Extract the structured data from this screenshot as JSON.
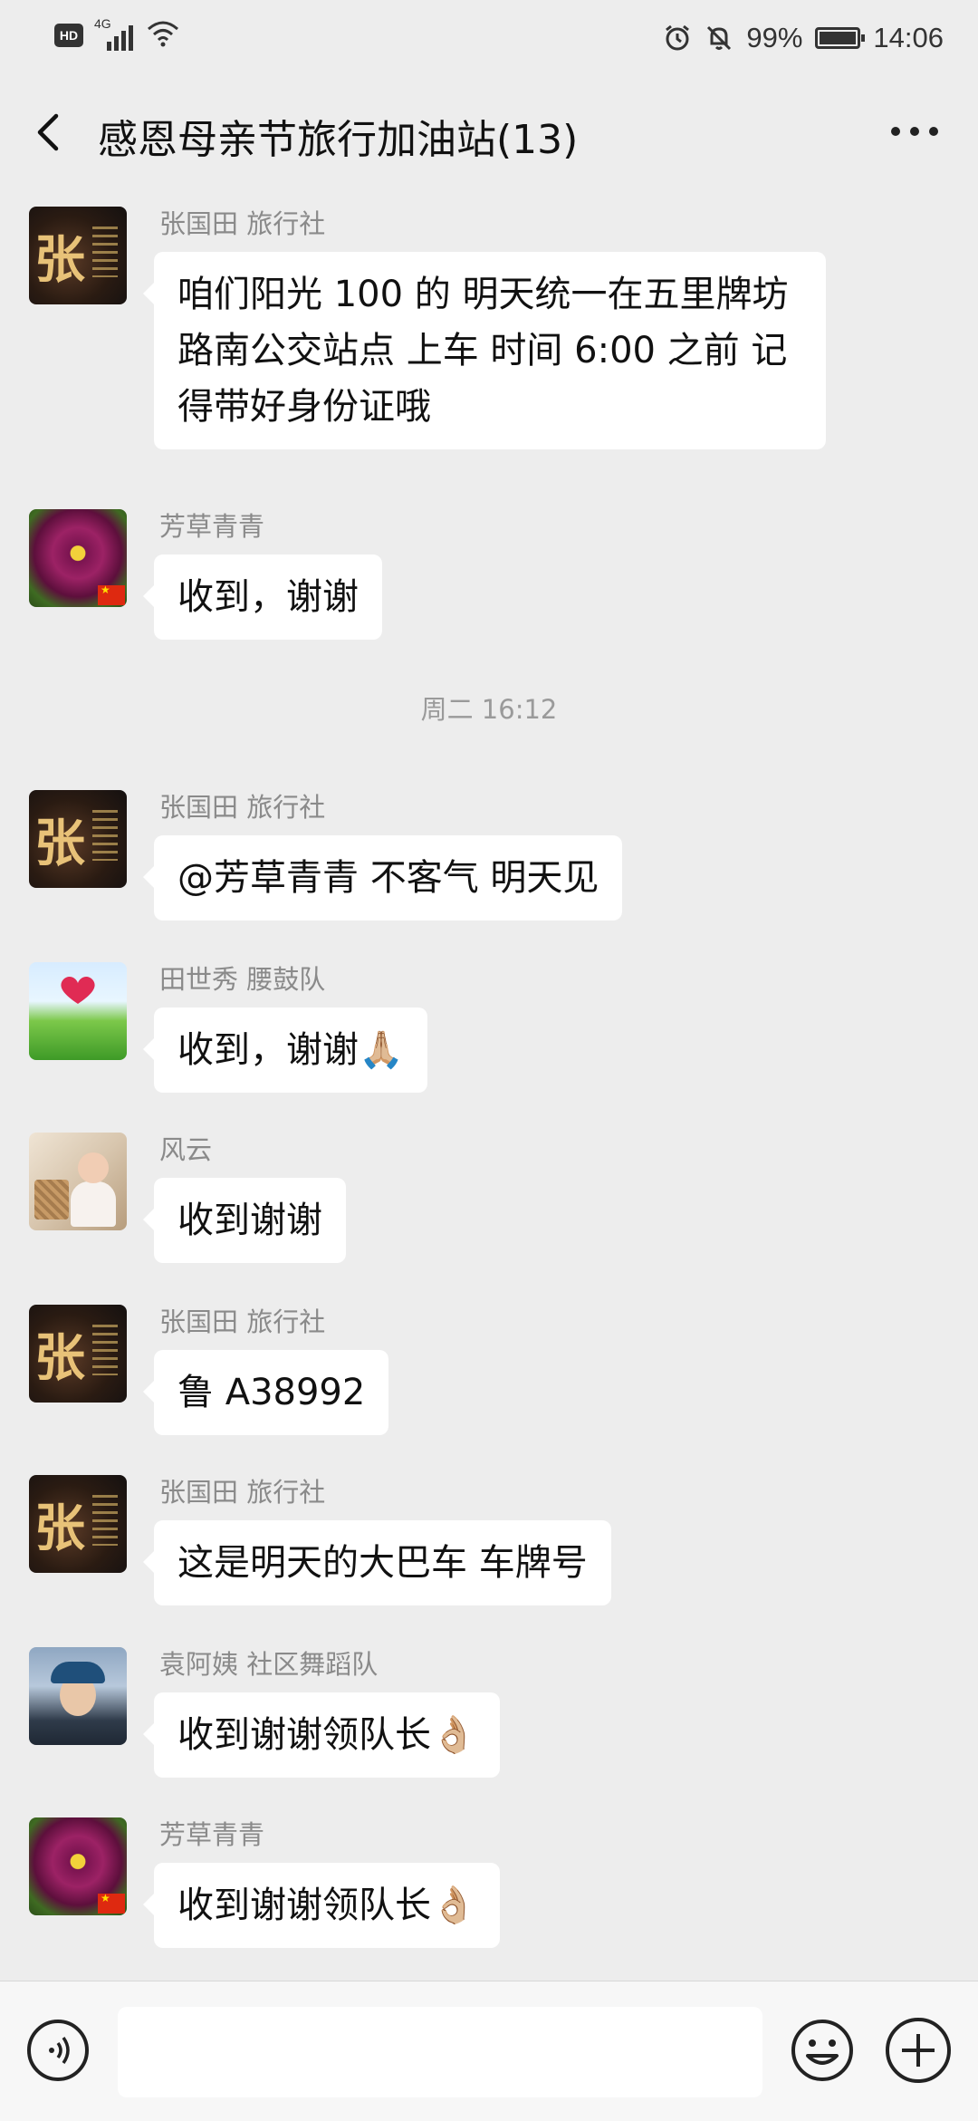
{
  "status_bar": {
    "hd_label": "HD",
    "network": "4G",
    "battery_percent": "99%",
    "battery_level": 0.99,
    "time": "14:06"
  },
  "header": {
    "title": "感恩母亲节旅行加油站(13)"
  },
  "messages": [
    {
      "sender": "张国田 旅行社",
      "avatar": "zhang",
      "text": "咱们阳光 100 的 明天统一在五里牌坊路南公交站点 上车 时间 6:00 之前 记得带好身份证哦"
    },
    {
      "sender": "芳草青青",
      "avatar": "fang",
      "text": "收到，谢谢"
    },
    {
      "sender": "张国田 旅行社",
      "avatar": "zhang",
      "text": "@芳草青青  不客气 明天见"
    },
    {
      "sender": "田世秀 腰鼓队",
      "avatar": "tian",
      "text": "收到，谢谢🙏🏼"
    },
    {
      "sender": "风云",
      "avatar": "feng",
      "text": "收到谢谢"
    },
    {
      "sender": "张国田 旅行社",
      "avatar": "zhang",
      "text": "鲁 A38992"
    },
    {
      "sender": "张国田 旅行社",
      "avatar": "zhang",
      "text": "这是明天的大巴车 车牌号"
    },
    {
      "sender": "袁阿姨 社区舞蹈队",
      "avatar": "yuan",
      "text": "收到谢谢领队长👌🏼"
    },
    {
      "sender": "芳草青青",
      "avatar": "fang",
      "text": "收到谢谢领队长👌🏼"
    }
  ],
  "timestamp": "周二 16:12",
  "avatar_glyph": "张",
  "icons": [
    "back-arrow-icon",
    "more-icon",
    "voice-icon",
    "emoji-icon",
    "plus-icon",
    "alarm-icon",
    "mute-icon",
    "wifi-icon",
    "signal-icon",
    "battery-icon"
  ]
}
